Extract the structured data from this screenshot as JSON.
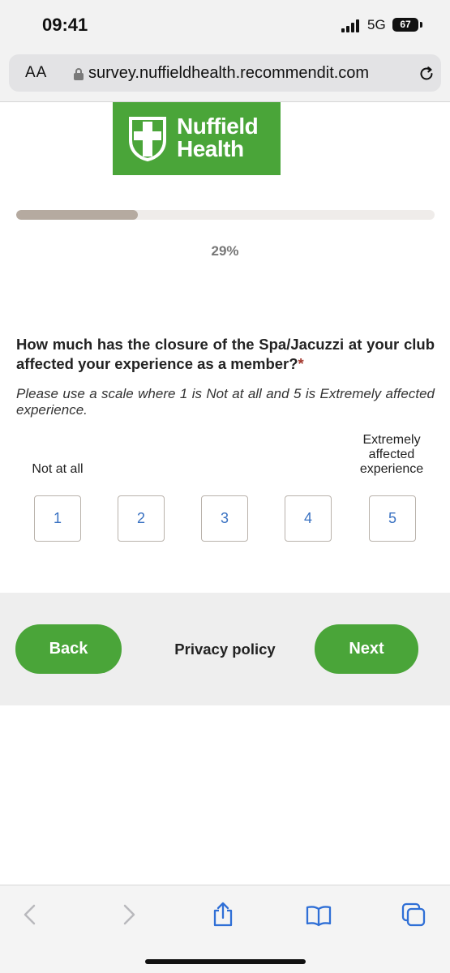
{
  "status_bar": {
    "time": "09:41",
    "network": "5G",
    "battery": "67"
  },
  "browser": {
    "text_size_label": "AA",
    "url": "survey.nuffieldhealth.recommendit.com",
    "icons": [
      "lock-icon",
      "reload-icon",
      "back-arrow-icon",
      "forward-arrow-icon",
      "share-icon",
      "bookmarks-icon",
      "tabs-icon"
    ]
  },
  "brand": {
    "name_line1": "Nuffield",
    "name_line2": "Health",
    "color": "#4aa539"
  },
  "progress": {
    "percent": 29,
    "label": "29%"
  },
  "question": {
    "text": "How much has the closure of the Spa/Jacuzzi at your club affected your experience as a member?",
    "required_mark": "*",
    "hint": "Please use a scale where 1 is Not at all and 5 is Extremely affected experience.",
    "anchor_low": "Not at all",
    "anchor_high": "Extremely affected experience",
    "options": [
      "1",
      "2",
      "3",
      "4",
      "5"
    ]
  },
  "footer": {
    "back_label": "Back",
    "privacy_label": "Privacy policy",
    "next_label": "Next"
  }
}
